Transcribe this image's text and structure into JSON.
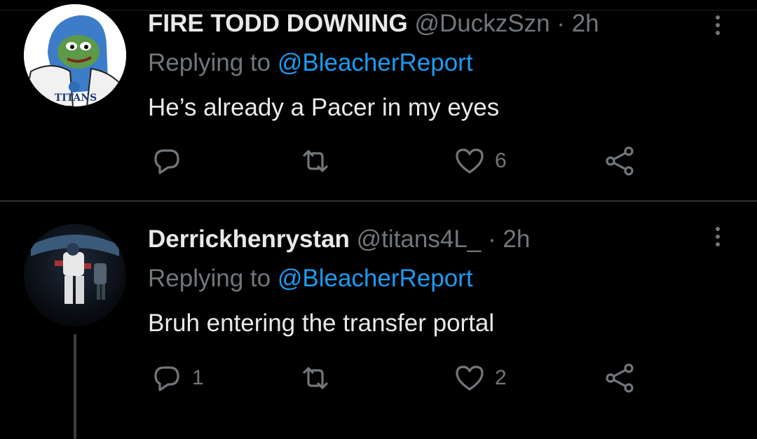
{
  "tweets": [
    {
      "name": "FIRE TODD DOWNING",
      "handle": "@DuckzSzn",
      "separator": "·",
      "time": "2h",
      "replying_prefix": "Replying to",
      "replying_to": "@BleacherReport",
      "text": "He’s already a Pacer in my eyes",
      "avatar_text": "TITANS",
      "replies": "",
      "retweets": "",
      "likes": "6"
    },
    {
      "name": "Derrickhenrystan",
      "handle": "@titans4L_",
      "separator": "·",
      "time": "2h",
      "replying_prefix": "Replying to",
      "replying_to": "@BleacherReport",
      "text": "Bruh entering the transfer portal",
      "replies": "1",
      "retweets": "",
      "likes": "2"
    }
  ],
  "colors": {
    "background": "#000000",
    "muted": "#71767b",
    "link": "#1d9bf0",
    "text": "#e7e9ea"
  },
  "icons": [
    "reply-icon",
    "retweet-icon",
    "like-icon",
    "share-icon",
    "more-icon"
  ]
}
